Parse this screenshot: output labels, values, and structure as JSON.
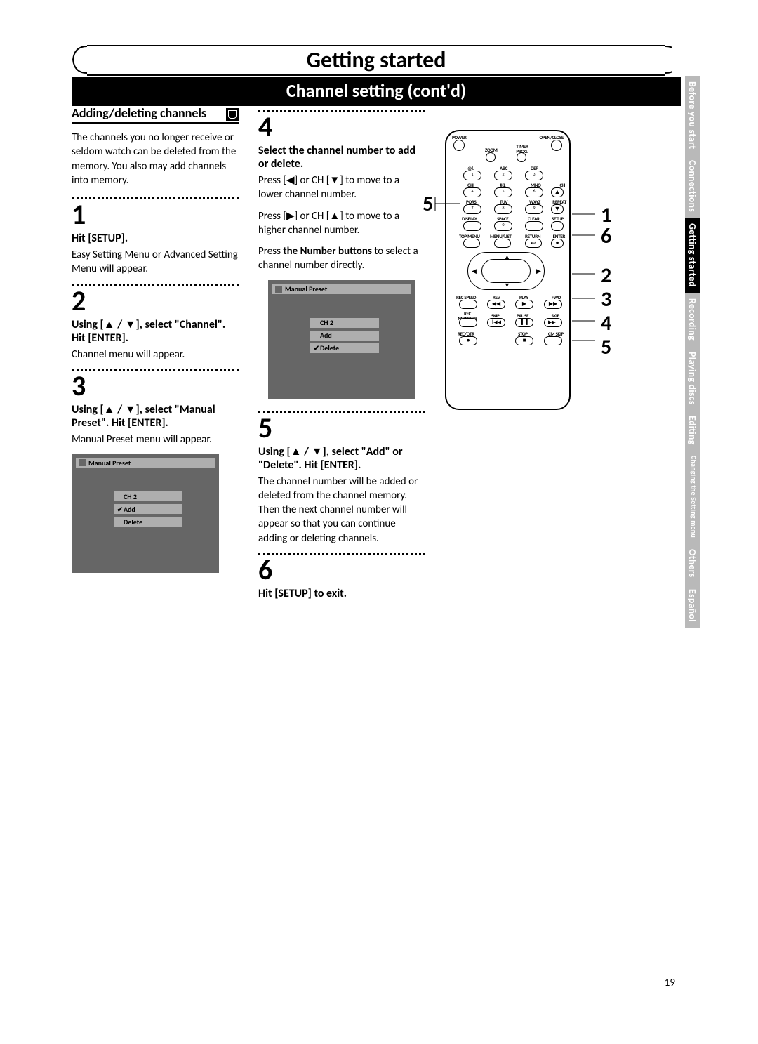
{
  "header": {
    "title": "Getting started"
  },
  "sub_banner": "Channel setting (cont'd)",
  "section": {
    "title": "Adding/deleting channels",
    "intro": "The channels you no longer receive or seldom watch can be deleted from the memory. You also may add channels into memory."
  },
  "steps": {
    "s1": {
      "num": "1",
      "head": "Hit [SETUP].",
      "body": "Easy Setting Menu or Advanced Setting Menu will appear."
    },
    "s2": {
      "num": "2",
      "head": "Using [▲ / ▼], select \"Channel\". Hit [ENTER].",
      "body": "Channel menu will appear."
    },
    "s3": {
      "num": "3",
      "head": "Using [▲ / ▼], select \"Manual Preset\". Hit [ENTER].",
      "body": "Manual Preset menu will appear."
    },
    "s4": {
      "num": "4",
      "head": "Select the channel number to add or delete.",
      "b1": "Press [◀] or CH [▼] to move to a lower channel number.",
      "b2": "Press [▶] or CH [▲] to move to a higher channel number.",
      "b3a": "Press ",
      "b3b": "the Number buttons",
      "b3c": " to select a channel number directly."
    },
    "s5": {
      "num": "5",
      "head": "Using [▲ / ▼], select \"Add\" or \"Delete\". Hit [ENTER].",
      "body": "The channel number will be added or deleted from the channel memory. Then the next channel number will appear so that you can continue adding or deleting channels."
    },
    "s6": {
      "num": "6",
      "head": "Hit [SETUP] to exit."
    }
  },
  "osd": {
    "title": "Manual Preset",
    "ch": "CH 2",
    "add": "Add",
    "del": "Delete"
  },
  "remote": {
    "power": "POWER",
    "openclose": "OPEN/CLOSE",
    "zoom": "ZOOM",
    "timer": "TIMER PROG.",
    "row1": [
      "@!.",
      "ABC",
      "DEF"
    ],
    "row2": [
      "GHI",
      "JKL",
      "MNO"
    ],
    "row3": [
      "PQRS",
      "TUV",
      "WXYZ"
    ],
    "nums": [
      "1",
      "2",
      "3",
      "4",
      "5",
      "6",
      "7",
      "8",
      "9",
      "0"
    ],
    "ch": "CH",
    "repeat": "REPEAT",
    "display": "DISPLAY",
    "space": "SPACE",
    "clear": "CLEAR",
    "setup": "SETUP",
    "topmenu": "TOP MENU",
    "menulist": "MENU/LIST",
    "return": "RETURN",
    "enter": "ENTER",
    "recspeed": "REC SPEED",
    "rev": "REV",
    "play": "PLAY",
    "fwd": "FWD",
    "recmon": "REC MONITOR",
    "skip": "SKIP",
    "pause": "PAUSE",
    "skip2": "SKIP",
    "recotr": "REC/OTR",
    "stop": "STOP",
    "cmskip": "CM SKIP"
  },
  "callouts": {
    "left": "5",
    "r1": "1",
    "r2": "6",
    "r3": "2",
    "r4": "3",
    "r5": "4",
    "r6": "5"
  },
  "tabs": [
    "Before you start",
    "Connections",
    "Getting started",
    "Recording",
    "Playing discs",
    "Editing",
    "Changing the Setting menu",
    "Others",
    "Español"
  ],
  "page_number": "19"
}
